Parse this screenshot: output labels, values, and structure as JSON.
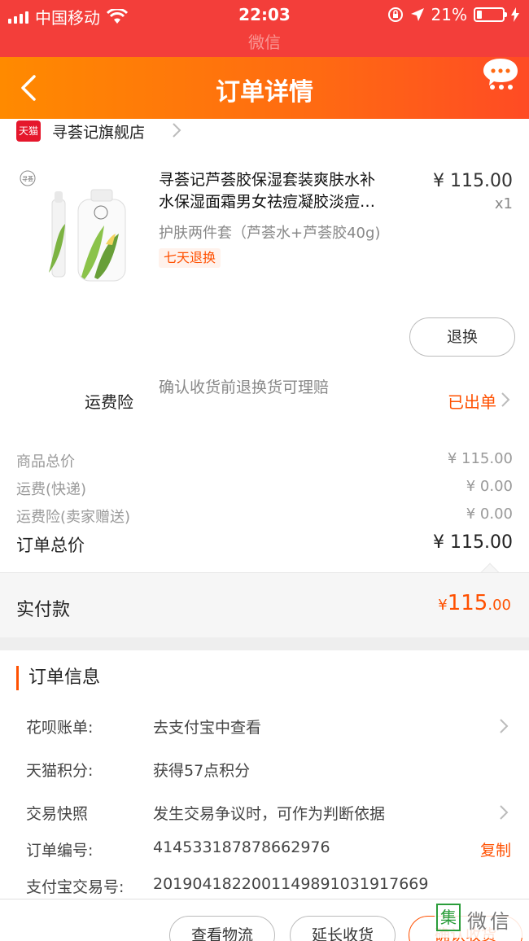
{
  "status_bar": {
    "carrier": "中国移动",
    "time": "22:03",
    "battery": "21%"
  },
  "sub_bar": {
    "ghost_title": "微信"
  },
  "nav": {
    "title": "订单详情"
  },
  "store": {
    "badge": "天猫",
    "name": "寻荟记旗舰店"
  },
  "product": {
    "title_line1": "寻荟记芦荟胶保湿套装爽肤水补",
    "title_line2": "水保湿面霜男女祛痘凝胶淡痘…",
    "price": "¥ 115.00",
    "quantity": "x1",
    "sku": "护肤两件套（芦荟水+芦荟胶40g)",
    "tag": "七天退换",
    "refund_button": "退换"
  },
  "insurance": {
    "label": "运费险",
    "desc": "确认收货前退换货可理赔",
    "status": "已出单"
  },
  "price_lines": [
    {
      "label": "商品总价",
      "value": "¥ 115.00"
    },
    {
      "label": "运费(快递)",
      "value": "¥ 0.00"
    },
    {
      "label": "运费险(卖家赠送)",
      "value": "¥ 0.00"
    }
  ],
  "total": {
    "label": "订单总价",
    "value": "¥ 115.00"
  },
  "paid": {
    "label": "实付款",
    "symbol": "¥",
    "integer": "115",
    "decimal": ".00"
  },
  "order_info": {
    "title": "订单信息",
    "rows": [
      {
        "key": "花呗账单:",
        "value": "去支付宝中查看"
      },
      {
        "key": "天猫积分:",
        "value": "获得57点积分"
      },
      {
        "key": "交易快照",
        "value": "发生交易争议时，可作为判断依据"
      },
      {
        "key": "订单编号:",
        "value": "414533187878662976",
        "action": "复制"
      },
      {
        "key": "支付宝交易号:",
        "value": "2019041822001149891031917669"
      }
    ]
  },
  "bottom_actions": {
    "logistics": "查看物流",
    "extend": "延长收货",
    "confirm": "确认收货"
  },
  "watermark": {
    "mark": "集",
    "text": "微信"
  },
  "colors": {
    "status_bg": "#f33e3a",
    "nav_gradient_start": "#ff8a00",
    "nav_gradient_end": "#ff4b24",
    "accent": "#ff5000"
  }
}
